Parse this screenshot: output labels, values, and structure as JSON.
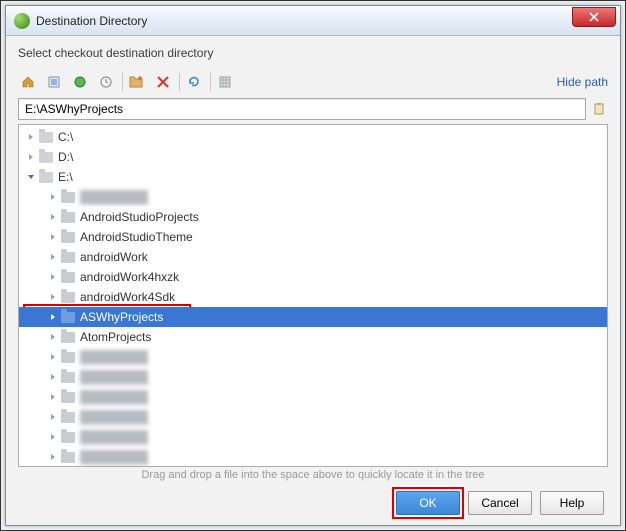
{
  "window": {
    "title": "Destination Directory",
    "close_label": "Close"
  },
  "instruction": "Select checkout destination directory",
  "toolbar": {
    "home": "home",
    "module": "module",
    "project": "project",
    "recent": "recent",
    "new_folder": "new-folder",
    "delete": "delete",
    "refresh": "refresh",
    "show_hidden": "show-hidden",
    "hide_path_label": "Hide path"
  },
  "path": {
    "value": "E:\\ASWhyProjects"
  },
  "tree": [
    {
      "depth": 0,
      "expanded": false,
      "kind": "drive",
      "label": "C:\\"
    },
    {
      "depth": 0,
      "expanded": false,
      "kind": "drive",
      "label": "D:\\"
    },
    {
      "depth": 0,
      "expanded": true,
      "kind": "drive",
      "label": "E:\\"
    },
    {
      "depth": 1,
      "expanded": false,
      "kind": "folder",
      "label": "",
      "blur": true
    },
    {
      "depth": 1,
      "expanded": false,
      "kind": "folder",
      "label": "AndroidStudioProjects"
    },
    {
      "depth": 1,
      "expanded": false,
      "kind": "folder",
      "label": "AndroidStudioTheme"
    },
    {
      "depth": 1,
      "expanded": false,
      "kind": "folder",
      "label": "androidWork"
    },
    {
      "depth": 1,
      "expanded": false,
      "kind": "folder",
      "label": "androidWork4hxzk"
    },
    {
      "depth": 1,
      "expanded": false,
      "kind": "folder",
      "label": "androidWork4Sdk"
    },
    {
      "depth": 1,
      "expanded": false,
      "kind": "folder",
      "label": "ASWhyProjects",
      "selected": true
    },
    {
      "depth": 1,
      "expanded": false,
      "kind": "folder",
      "label": "AtomProjects"
    },
    {
      "depth": 1,
      "expanded": false,
      "kind": "folder",
      "label": "",
      "blur": true
    },
    {
      "depth": 1,
      "expanded": false,
      "kind": "folder",
      "label": "",
      "blur": true
    },
    {
      "depth": 1,
      "expanded": false,
      "kind": "folder",
      "label": "",
      "blur": true
    },
    {
      "depth": 1,
      "expanded": false,
      "kind": "folder",
      "label": "",
      "blur": true
    },
    {
      "depth": 1,
      "expanded": false,
      "kind": "folder",
      "label": "",
      "blur": true
    },
    {
      "depth": 1,
      "expanded": false,
      "kind": "folder",
      "label": "",
      "blur": true
    }
  ],
  "hint": "Drag and drop a file into the space above to quickly locate it in the tree",
  "buttons": {
    "ok": "OK",
    "cancel": "Cancel",
    "help": "Help"
  }
}
